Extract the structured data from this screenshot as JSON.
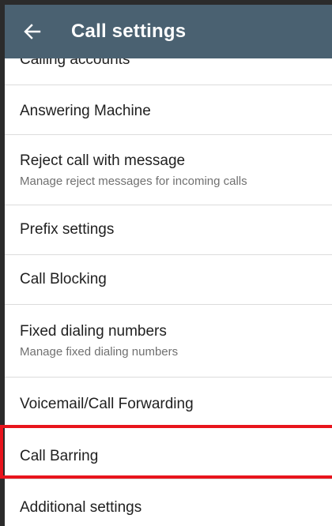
{
  "header": {
    "title": "Call settings",
    "back_icon": "arrow-left-icon"
  },
  "list": {
    "items": [
      {
        "label": "Calling accounts"
      },
      {
        "label": "Answering Machine"
      },
      {
        "label": "Reject call with message",
        "subtitle": "Manage reject messages for incoming calls"
      },
      {
        "label": "Prefix settings"
      },
      {
        "label": "Call Blocking"
      },
      {
        "label": "Fixed dialing numbers",
        "subtitle": "Manage fixed dialing numbers"
      },
      {
        "label": "Voicemail/Call Forwarding"
      },
      {
        "label": "Call Barring",
        "highlighted": true
      },
      {
        "label": "Additional settings"
      }
    ]
  },
  "colors": {
    "app_bar": "#4a6171",
    "highlight": "#e8141c"
  }
}
